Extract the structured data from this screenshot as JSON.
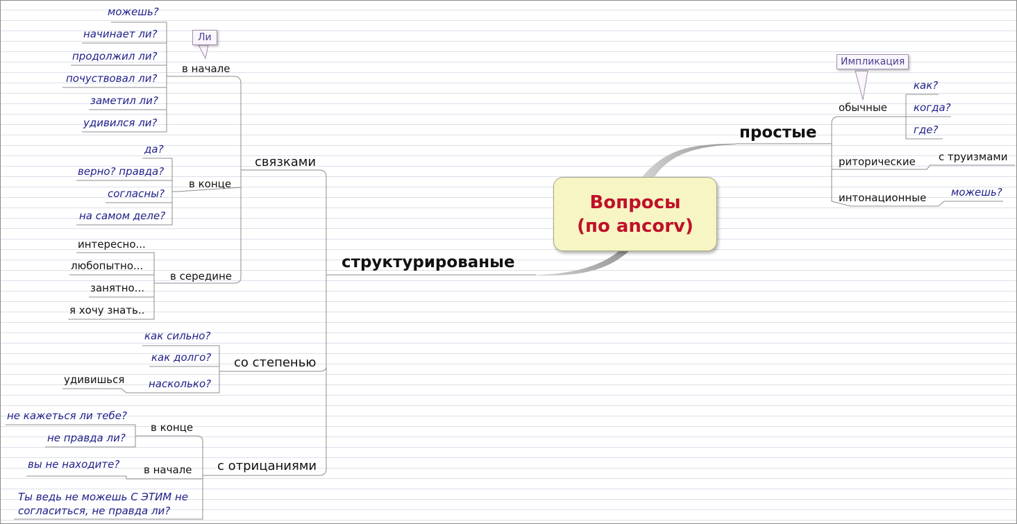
{
  "center": {
    "line1": "Вопросы",
    "line2": "(по ancorv)"
  },
  "simple": {
    "label": "простые",
    "ordinary": {
      "label": "обычные",
      "callout": "Импликация",
      "leaves": [
        "как?",
        "когда?",
        "где?"
      ]
    },
    "rhetorical": {
      "label": "риторические",
      "leaf": "с труизмами"
    },
    "intonation": {
      "label": "интонационные",
      "leaf": "можешь?"
    }
  },
  "structured": {
    "label": "структурированые",
    "connectors": {
      "label": "связками",
      "beginning": {
        "label": "в начале",
        "callout": "Ли",
        "leaves": [
          "можешь?",
          "начинает ли?",
          "продолжил ли?",
          "почуствовал ли?",
          "заметил ли?",
          "удивился ли?"
        ]
      },
      "end": {
        "label": "в конце",
        "leaves": [
          "да?",
          "верно? правда?",
          "согласны?",
          "на самом деле?"
        ]
      },
      "middle": {
        "label": "в середине",
        "leaves": [
          "интересно...",
          "любопытно...",
          "занятно...",
          "я хочу знать.."
        ]
      }
    },
    "degree": {
      "label": "со степенью",
      "leaves": [
        "как сильно?",
        "как долго?",
        "насколько?"
      ],
      "sub_leaf": "удивишься"
    },
    "negation": {
      "label": "с отрицаниями",
      "end": {
        "label": "в конце",
        "leaves": [
          "не кажеться ли тебе?",
          "не правда ли?"
        ]
      },
      "beginning": {
        "label": "в начале",
        "leaves": [
          "вы не находите?",
          "Ты ведь не можешь С ЭТИМ не",
          "согласиться, не правда ли?"
        ]
      }
    }
  }
}
